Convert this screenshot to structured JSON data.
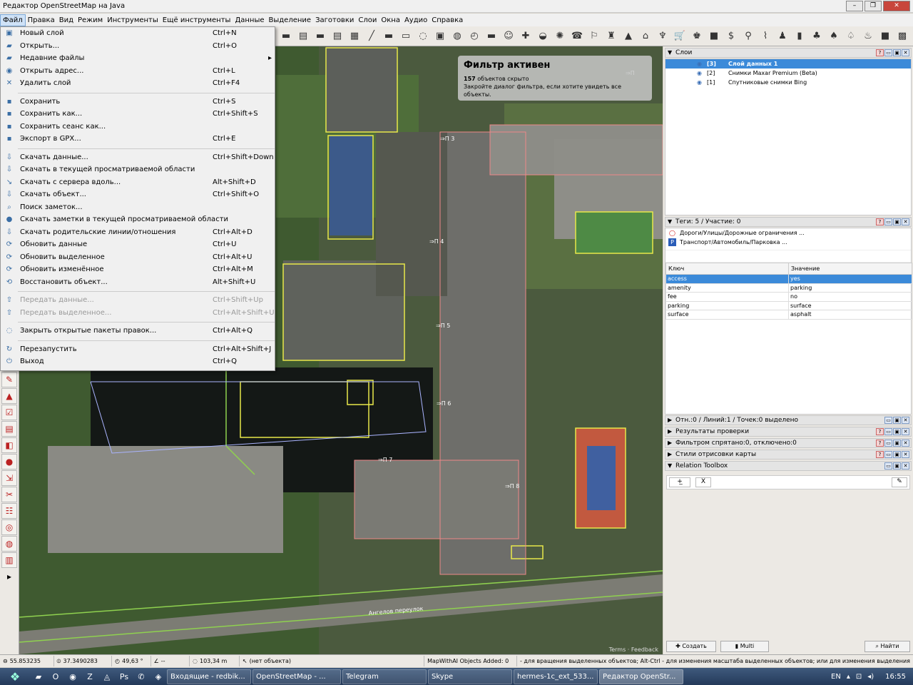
{
  "window": {
    "title": "Редактор OpenStreetMap на Java"
  },
  "menubar": [
    "Файл",
    "Правка",
    "Вид",
    "Режим",
    "Инструменты",
    "Ещё инструменты",
    "Данные",
    "Выделение",
    "Заготовки",
    "Слои",
    "Окна",
    "Аудио",
    "Справка"
  ],
  "file_menu": [
    {
      "icon": "new-layer-icon",
      "glyph": "▣",
      "label": "Новый слой",
      "shortcut": "Ctrl+N"
    },
    {
      "icon": "open-folder-icon",
      "glyph": "▰",
      "label": "Открыть...",
      "shortcut": "Ctrl+O"
    },
    {
      "icon": "recent-files-icon",
      "glyph": "▰",
      "label": "Недавние файлы",
      "shortcut": "",
      "submenu": true
    },
    {
      "icon": "open-location-icon",
      "glyph": "◉",
      "label": "Открыть адрес...",
      "shortcut": "Ctrl+L"
    },
    {
      "icon": "delete-layer-icon",
      "glyph": "✕",
      "label": "Удалить слой",
      "shortcut": "Ctrl+F4",
      "sep": true
    },
    {
      "icon": "save-icon",
      "glyph": "▪",
      "label": "Сохранить",
      "shortcut": "Ctrl+S"
    },
    {
      "icon": "save-as-icon",
      "glyph": "▪",
      "label": "Сохранить как...",
      "shortcut": "Ctrl+Shift+S"
    },
    {
      "icon": "save-session-icon",
      "glyph": "▪",
      "label": "Сохранить сеанс как...",
      "shortcut": ""
    },
    {
      "icon": "export-gpx-icon",
      "glyph": "▪",
      "label": "Экспорт в GPX...",
      "shortcut": "Ctrl+E",
      "sep": true
    },
    {
      "icon": "download-icon",
      "glyph": "⇩",
      "label": "Скачать данные...",
      "shortcut": "Ctrl+Shift+Down"
    },
    {
      "icon": "download-in-view-icon",
      "glyph": "⇩",
      "label": "Скачать в текущей просматриваемой области",
      "shortcut": ""
    },
    {
      "icon": "download-along-icon",
      "glyph": "↘",
      "label": "Скачать с сервера вдоль...",
      "shortcut": "Alt+Shift+D"
    },
    {
      "icon": "download-object-icon",
      "glyph": "⇩",
      "label": "Скачать объект...",
      "shortcut": "Ctrl+Shift+O"
    },
    {
      "icon": "search-notes-icon",
      "glyph": "⌕",
      "label": "Поиск заметок...",
      "shortcut": ""
    },
    {
      "icon": "download-notes-icon",
      "glyph": "●",
      "label": "Скачать заметки в текущей просматриваемой области",
      "shortcut": ""
    },
    {
      "icon": "download-parents-icon",
      "glyph": "⇩",
      "label": "Скачать родительские линии/отношения",
      "shortcut": "Ctrl+Alt+D"
    },
    {
      "icon": "update-data-icon",
      "glyph": "⟳",
      "label": "Обновить данные",
      "shortcut": "Ctrl+U"
    },
    {
      "icon": "update-selection-icon",
      "glyph": "⟳",
      "label": "Обновить выделенное",
      "shortcut": "Ctrl+Alt+U"
    },
    {
      "icon": "update-modified-icon",
      "glyph": "⟳",
      "label": "Обновить изменённое",
      "shortcut": "Ctrl+Alt+M"
    },
    {
      "icon": "restore-object-icon",
      "glyph": "⟲",
      "label": "Восстановить объект...",
      "shortcut": "Alt+Shift+U",
      "sep": true
    },
    {
      "icon": "upload-icon",
      "glyph": "⇧",
      "label": "Передать данные...",
      "shortcut": "Ctrl+Shift+Up",
      "disabled": true
    },
    {
      "icon": "upload-selection-icon",
      "glyph": "⇧",
      "label": "Передать выделенное...",
      "shortcut": "Ctrl+Alt+Shift+U",
      "disabled": true,
      "sep": true
    },
    {
      "icon": "close-changesets-icon",
      "glyph": "◌",
      "label": "Закрыть открытые пакеты правок...",
      "shortcut": "Ctrl+Alt+Q",
      "sep": true
    },
    {
      "icon": "restart-icon",
      "glyph": "↻",
      "label": "Перезапустить",
      "shortcut": "Ctrl+Alt+Shift+J"
    },
    {
      "icon": "exit-icon",
      "glyph": "⏻",
      "label": "Выход",
      "shortcut": "Ctrl+Q"
    }
  ],
  "filter": {
    "title": "Фильтр активен",
    "count": "157",
    "line1": "объектов скрыто",
    "line2": "Закройте диалог фильтра, если хотите увидеть все объекты."
  },
  "map_labels": {
    "street": "Ангелов переулок",
    "p3": "⇒П 3",
    "p4": "⇒П 4",
    "p5": "⇒П 5",
    "p6": "⇒П 6",
    "p7": "⇒П 7",
    "p8": "⇒П 8",
    "pt": "⇒П",
    "terms": "Terms · Feedback"
  },
  "layers": {
    "header": "Слои",
    "items": [
      {
        "index": "[3]",
        "name": "Слой данных 1",
        "selected": true
      },
      {
        "index": "[2]",
        "name": "Снимки Maxar Premium (Beta)",
        "selected": false
      },
      {
        "index": "[1]",
        "name": "Спутниковые снимки Bing",
        "selected": false
      }
    ]
  },
  "tags": {
    "header": "Теги: 5 / Участие: 0",
    "presets": [
      "Дороги/Улицы/Дорожные ограничения ...",
      "Транспорт/Автомобиль/Парковка ..."
    ],
    "col_key": "Ключ",
    "col_value": "Значение",
    "rows": [
      {
        "key": "access",
        "value": "yes",
        "selected": true
      },
      {
        "key": "amenity",
        "value": "parking"
      },
      {
        "key": "fee",
        "value": "no"
      },
      {
        "key": "parking",
        "value": "surface"
      },
      {
        "key": "surface",
        "value": "asphalt"
      }
    ]
  },
  "panels": [
    "Отн.:0 / Линий:1 / Точек:0 выделено",
    "Результаты проверки",
    "Фильтром спрятано:0, отключено:0",
    "Стили отрисовки карты",
    "Relation Toolbox"
  ],
  "buttons": {
    "create": "Создать",
    "multi": "Multi",
    "find": "Найти",
    "x": "X"
  },
  "status": {
    "lat": "55.853235",
    "lon": "37.3490283",
    "heading": "49,63 °",
    "angle": "--",
    "distance": "103,34 m",
    "object": "(нет объекта)",
    "mapwithai": "MapWithAI Objects Added: 0",
    "help": "- для вращения выделенных объектов; Alt-Ctrl - для изменения масштаба выделенных объектов; или для изменения выделения"
  },
  "taskbar": {
    "tasks": [
      "Входящие - redbik...",
      "OpenStreetMap - ...",
      "Telegram",
      "Skype",
      "hermes-1c_ext_533...",
      "Редактор OpenStr..."
    ],
    "lang": "EN",
    "time": "16:55"
  }
}
